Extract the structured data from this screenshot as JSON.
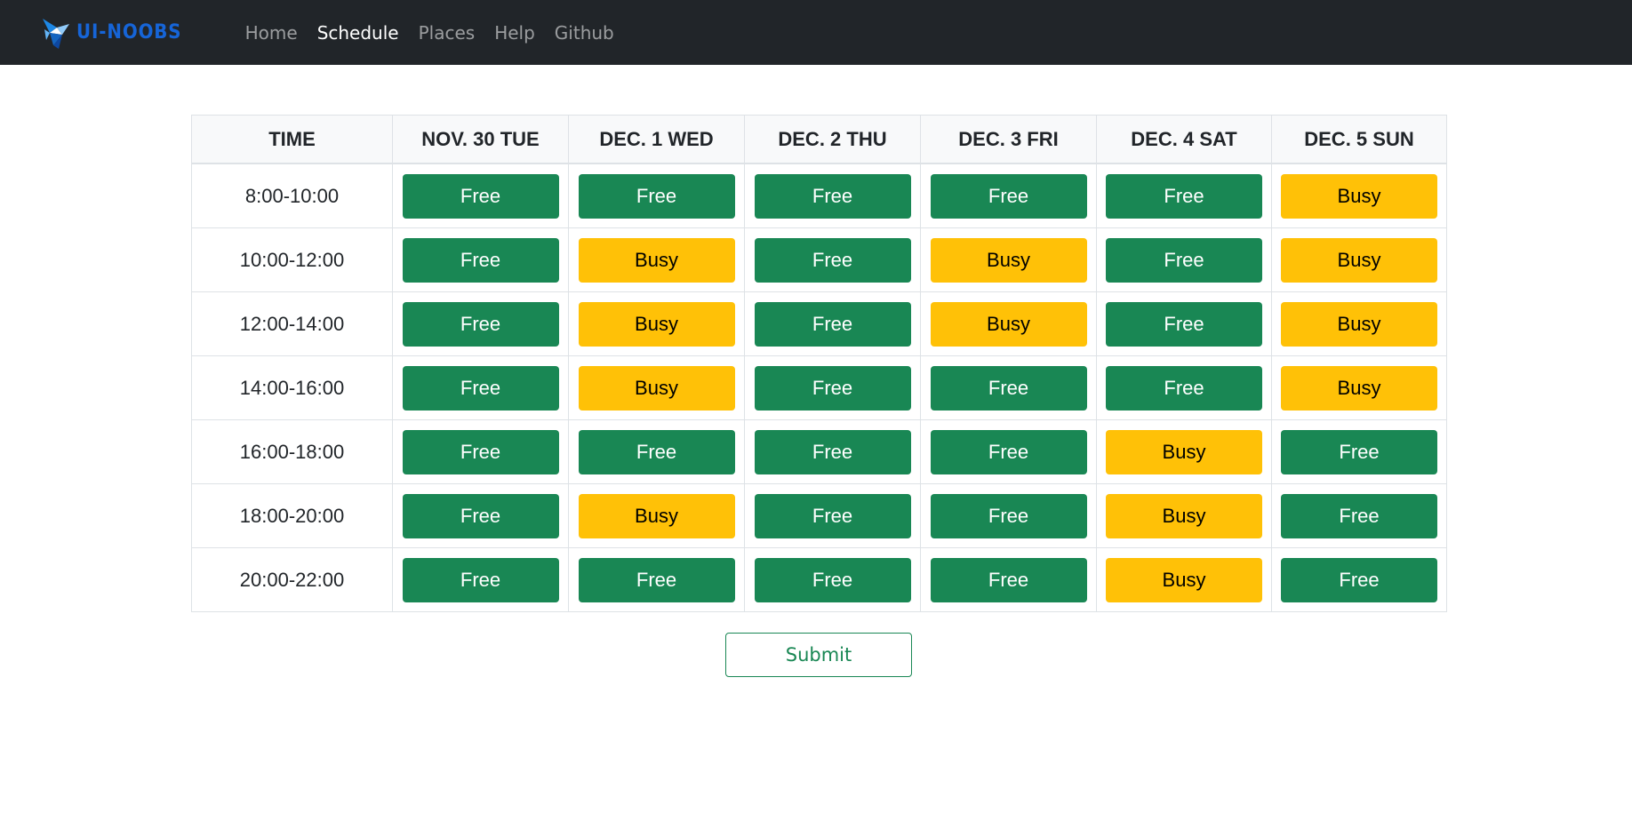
{
  "brand": {
    "logo": "crane-bird-logo",
    "text": "UI-NOOBS"
  },
  "nav": {
    "items": [
      {
        "label": "Home",
        "active": false
      },
      {
        "label": "Schedule",
        "active": true
      },
      {
        "label": "Places",
        "active": false
      },
      {
        "label": "Help",
        "active": false
      },
      {
        "label": "Github",
        "active": false
      }
    ]
  },
  "schedule": {
    "headers": [
      "TIME",
      "NOV. 30 TUE",
      "DEC. 1 WED",
      "DEC. 2 THU",
      "DEC. 3 FRI",
      "DEC. 4 SAT",
      "DEC. 5 SUN"
    ],
    "rows": [
      {
        "time": "8:00-10:00",
        "slots": [
          "Free",
          "Free",
          "Free",
          "Free",
          "Free",
          "Busy"
        ]
      },
      {
        "time": "10:00-12:00",
        "slots": [
          "Free",
          "Busy",
          "Free",
          "Busy",
          "Free",
          "Busy"
        ]
      },
      {
        "time": "12:00-14:00",
        "slots": [
          "Free",
          "Busy",
          "Free",
          "Busy",
          "Free",
          "Busy"
        ]
      },
      {
        "time": "14:00-16:00",
        "slots": [
          "Free",
          "Busy",
          "Free",
          "Free",
          "Free",
          "Busy"
        ]
      },
      {
        "time": "16:00-18:00",
        "slots": [
          "Free",
          "Free",
          "Free",
          "Free",
          "Busy",
          "Free"
        ]
      },
      {
        "time": "18:00-20:00",
        "slots": [
          "Free",
          "Busy",
          "Free",
          "Free",
          "Busy",
          "Free"
        ]
      },
      {
        "time": "20:00-22:00",
        "slots": [
          "Free",
          "Free",
          "Free",
          "Free",
          "Busy",
          "Free"
        ]
      }
    ]
  },
  "submit": {
    "label": "Submit"
  },
  "colors": {
    "navbar": "#212529",
    "brand": "#1665d8",
    "free": "#198754",
    "busy": "#ffc107"
  }
}
